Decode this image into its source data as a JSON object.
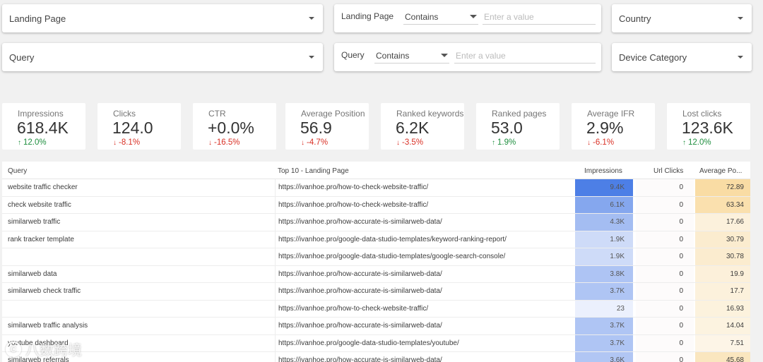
{
  "filters": {
    "landing_page_dd": "Landing Page",
    "query_dd": "Query",
    "country_dd": "Country",
    "device_dd": "Device Category",
    "lp_filter": {
      "name": "Landing Page",
      "op": "Contains",
      "placeholder": "Enter a value"
    },
    "q_filter": {
      "name": "Query",
      "op": "Contains",
      "placeholder": "Enter a value"
    }
  },
  "kpis": [
    {
      "label": "Impressions",
      "value": "618.4K",
      "delta": "12.0%",
      "dir": "up"
    },
    {
      "label": "Clicks",
      "value": "124.0",
      "delta": "-8.1%",
      "dir": "down"
    },
    {
      "label": "CTR",
      "value": "+0.0%",
      "delta": "-16.5%",
      "dir": "down"
    },
    {
      "label": "Average Position",
      "value": "56.9",
      "delta": "-4.7%",
      "dir": "down"
    },
    {
      "label": "Ranked keywords",
      "value": "6.2K",
      "delta": "-3.5%",
      "dir": "down"
    },
    {
      "label": "Ranked pages",
      "value": "53.0",
      "delta": "1.9%",
      "dir": "up"
    },
    {
      "label": "Average IFR",
      "value": "2.9%",
      "delta": "-6.1%",
      "dir": "down"
    },
    {
      "label": "Lost clicks",
      "value": "123.6K",
      "delta": "12.0%",
      "dir": "up"
    }
  ],
  "table": {
    "headers": {
      "query": "Query",
      "landing": "Top 10 - Landing Page",
      "impressions": "Impressions",
      "url_clicks": "Url Clicks",
      "avg_pos": "Average Po..."
    },
    "rows": [
      {
        "query": "website traffic checker",
        "url": "https://ivanhoe.pro/how-to-check-website-traffic/",
        "impressions": "9.4K",
        "url_clicks": "0",
        "avg_pos": "72.89",
        "imp_level": 1.0,
        "pos_level": 1.0
      },
      {
        "query": "check website traffic",
        "url": "https://ivanhoe.pro/how-to-check-website-traffic/",
        "impressions": "6.1K",
        "url_clicks": "0",
        "avg_pos": "63.34",
        "imp_level": 0.65,
        "pos_level": 0.87
      },
      {
        "query": "similarweb traffic",
        "url": "https://ivanhoe.pro/how-accurate-is-similarweb-data/",
        "impressions": "4.3K",
        "url_clicks": "0",
        "avg_pos": "17.66",
        "imp_level": 0.46,
        "pos_level": 0.24
      },
      {
        "query": "rank tracker template",
        "url": "https://ivanhoe.pro/google-data-studio-templates/keyword-ranking-report/",
        "impressions": "1.9K",
        "url_clicks": "0",
        "avg_pos": "30.79",
        "imp_level": 0.2,
        "pos_level": 0.42
      },
      {
        "query": "",
        "url": "https://ivanhoe.pro/google-data-studio-templates/google-search-console/",
        "impressions": "1.9K",
        "url_clicks": "0",
        "avg_pos": "30.78",
        "imp_level": 0.2,
        "pos_level": 0.42
      },
      {
        "query": "similarweb data",
        "url": "https://ivanhoe.pro/how-accurate-is-similarweb-data/",
        "impressions": "3.8K",
        "url_clicks": "0",
        "avg_pos": "19.9",
        "imp_level": 0.4,
        "pos_level": 0.27
      },
      {
        "query": "similarweb check traffic",
        "url": "https://ivanhoe.pro/how-accurate-is-similarweb-data/",
        "impressions": "3.7K",
        "url_clicks": "0",
        "avg_pos": "17.7",
        "imp_level": 0.39,
        "pos_level": 0.24
      },
      {
        "query": "",
        "url": "https://ivanhoe.pro/how-to-check-website-traffic/",
        "impressions": "23",
        "url_clicks": "0",
        "avg_pos": "16.93",
        "imp_level": 0.02,
        "pos_level": 0.23
      },
      {
        "query": "similarweb traffic analysis",
        "url": "https://ivanhoe.pro/how-accurate-is-similarweb-data/",
        "impressions": "3.7K",
        "url_clicks": "0",
        "avg_pos": "14.04",
        "imp_level": 0.39,
        "pos_level": 0.19
      },
      {
        "query": "youtube dashboard",
        "url": "https://ivanhoe.pro/google-data-studio-templates/youtube/",
        "impressions": "3.7K",
        "url_clicks": "0",
        "avg_pos": "7.51",
        "imp_level": 0.39,
        "pos_level": 0.1
      },
      {
        "query": "similarweb referrals",
        "url": "https://ivanhoe.pro/how-accurate-is-similarweb-data/",
        "impressions": "3.6K",
        "url_clicks": "0",
        "avg_pos": "45.68",
        "imp_level": 0.38,
        "pos_level": 0.63
      }
    ]
  },
  "colors": {
    "imp_max": "#4d7fe6",
    "imp_min": "#eef2fd",
    "pos_max": "#f9dca4",
    "pos_min": "#fdf8ee"
  },
  "watermark": {
    "icon": "copyright-c",
    "text": "八数跨境"
  }
}
